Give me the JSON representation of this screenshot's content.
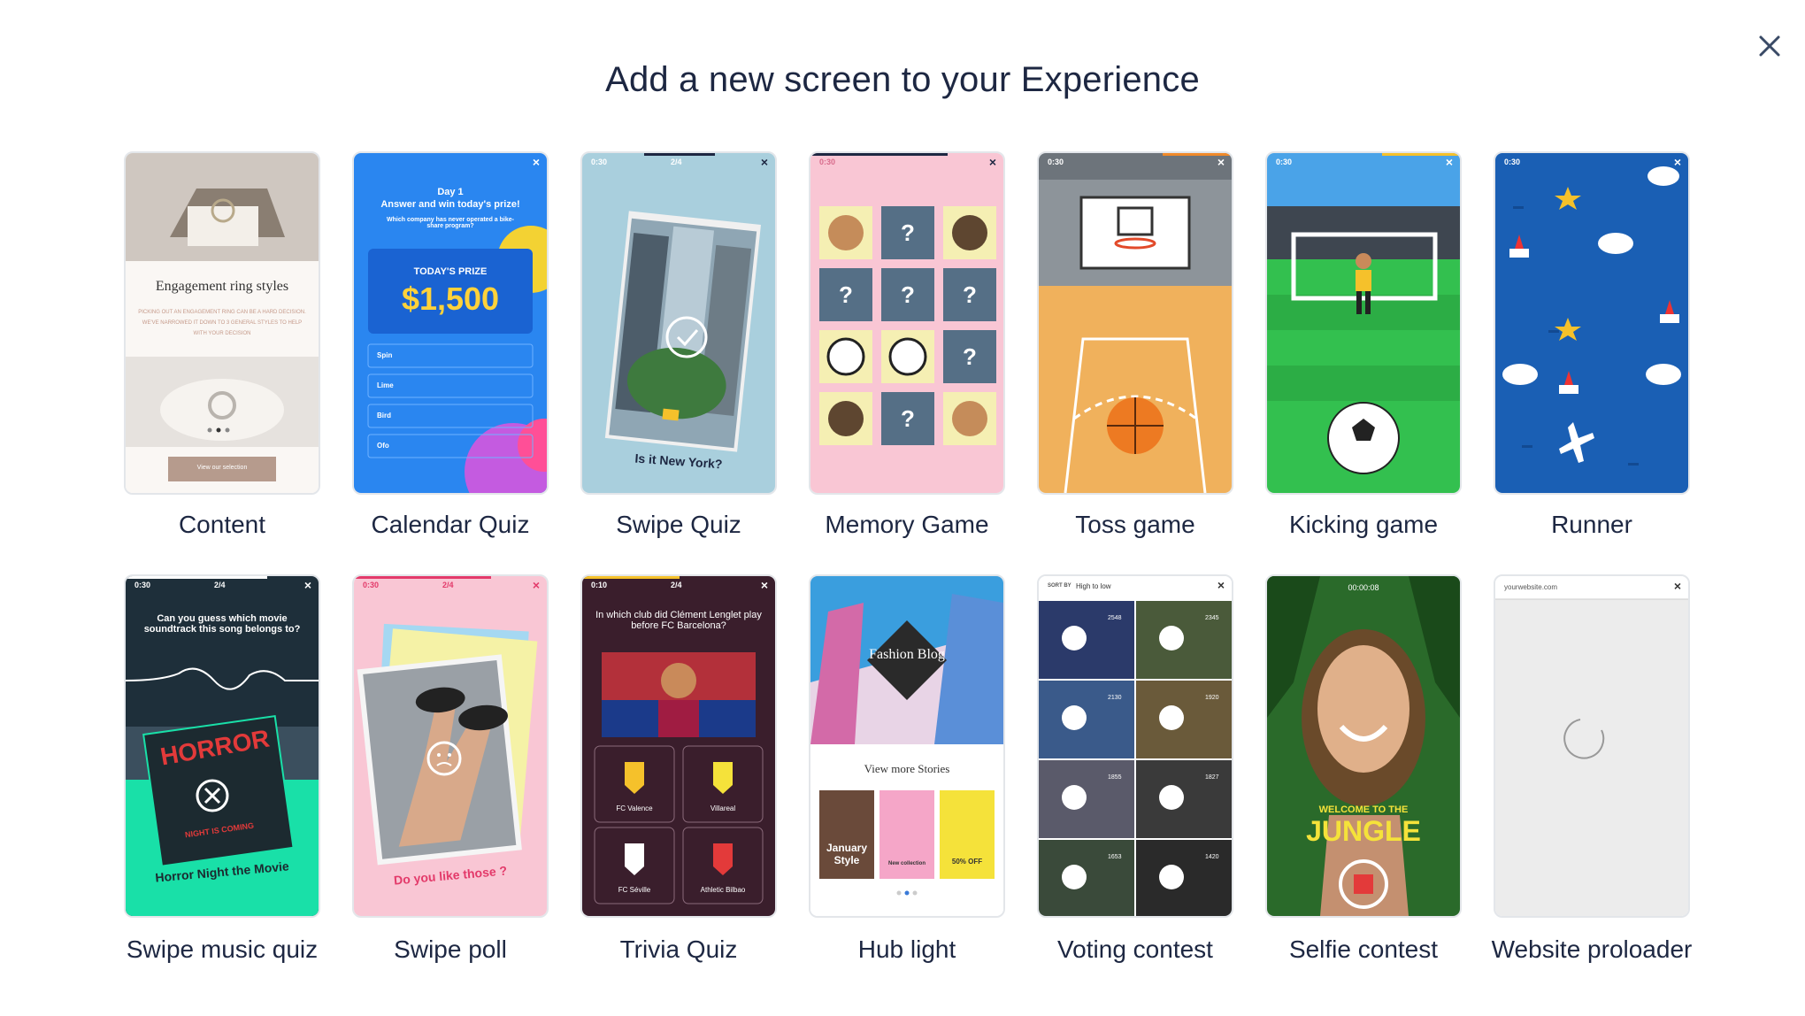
{
  "header": {
    "title": "Add a new screen to your Experience"
  },
  "cards": [
    {
      "label": "Content"
    },
    {
      "label": "Calendar Quiz"
    },
    {
      "label": "Swipe Quiz"
    },
    {
      "label": "Memory Game"
    },
    {
      "label": "Toss game"
    },
    {
      "label": "Kicking game"
    },
    {
      "label": "Runner"
    },
    {
      "label": "Swipe music quiz"
    },
    {
      "label": "Swipe poll"
    },
    {
      "label": "Trivia Quiz"
    },
    {
      "label": "Hub light"
    },
    {
      "label": "Voting contest"
    },
    {
      "label": "Selfie contest"
    },
    {
      "label": "Website proloader"
    }
  ],
  "previews": {
    "content": {
      "heading": "Engagement ring styles",
      "body": "PICKING OUT AN ENGAGEMENT RING CAN BE A HARD DECISION. WE'VE NARROWED IT DOWN TO 3 GENERAL STYLES TO HELP WITH YOUR DECISION",
      "button": "View our selection"
    },
    "calendar": {
      "day": "Day 1",
      "headline": "Answer and win today's prize!",
      "question": "Which company has never operated a bike-share program?",
      "prize_label": "TODAY'S PRIZE",
      "prize_amount": "$1,500",
      "options": [
        "Spin",
        "Lime",
        "Bird",
        "Ofo"
      ]
    },
    "swipe_quiz": {
      "timer": "0:30",
      "progress": "2/4",
      "question": "Is it New York?"
    },
    "memory": {
      "timer": "0:30"
    },
    "toss": {
      "timer": "0:30"
    },
    "kicking": {
      "timer": "0:30"
    },
    "runner": {
      "timer": "0:30"
    },
    "music": {
      "timer": "0:30",
      "progress": "2/4",
      "question": "Can you guess which movie soundtrack this song belongs to?",
      "poster_title": "HORROR",
      "poster_sub": "NIGHT IS COMING",
      "caption": "Horror Night the Movie"
    },
    "poll": {
      "timer": "0:30",
      "progress": "2/4",
      "caption": "Do you like those ?"
    },
    "trivia": {
      "timer": "0:10",
      "progress": "2/4",
      "question": "In which club did Clément Lenglet play before FC Barcelona?",
      "answers": [
        "FC Valence",
        "Villareal",
        "FC Séville",
        "Athletic Bilbao"
      ]
    },
    "hub": {
      "blog": "Fashion Blog",
      "more": "View more Stories",
      "story1": "January Style",
      "story2": "New collection",
      "story3": "50% OFF"
    },
    "voting": {
      "sort_label": "SORT BY",
      "sort_value": "High to low",
      "counts": [
        "2548",
        "2345",
        "2130",
        "1920",
        "1855",
        "1827",
        "1653",
        "1420"
      ]
    },
    "selfie": {
      "timer": "00:00:08",
      "welcome": "WELCOME TO THE",
      "jungle": "JUNGLE"
    },
    "website": {
      "url": "yourwebsite.com"
    }
  },
  "colors": {
    "accent": "#1d2742",
    "border": "#e3e6ea"
  }
}
